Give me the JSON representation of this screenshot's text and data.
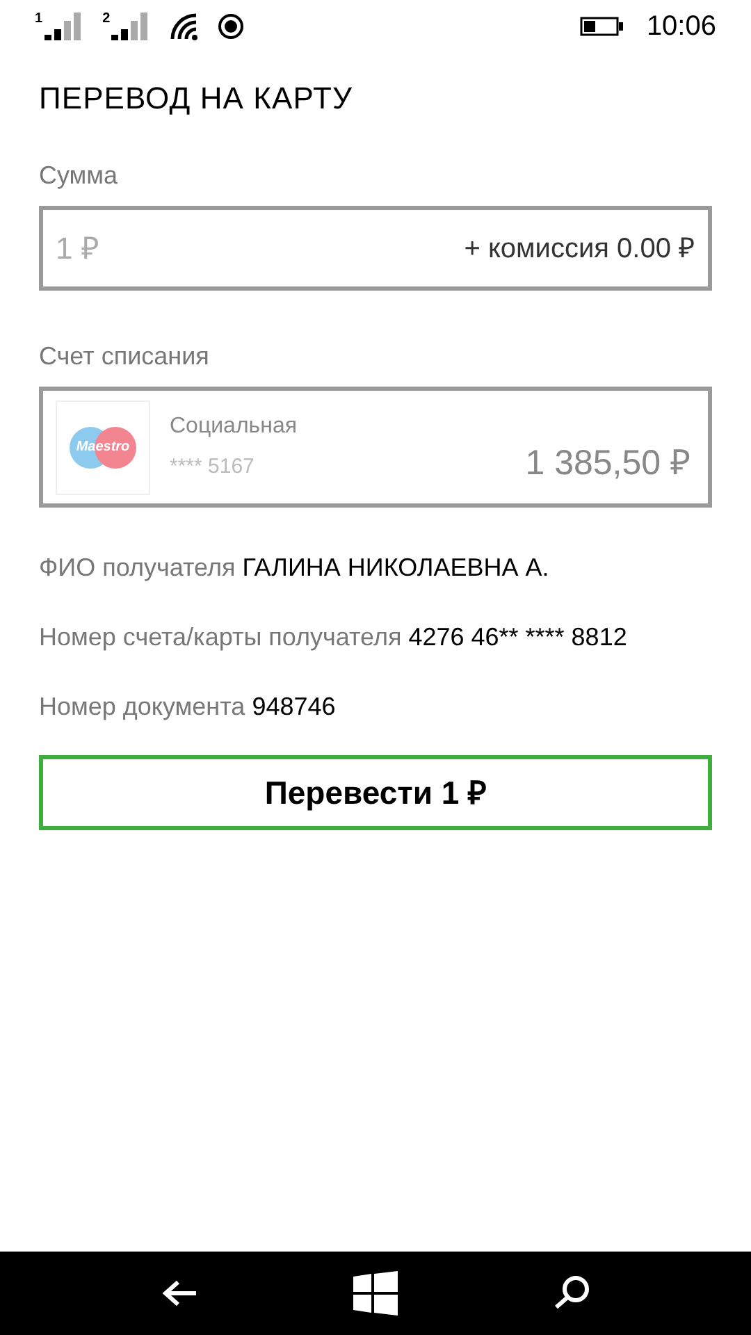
{
  "status_bar": {
    "sims": [
      {
        "label": "1"
      },
      {
        "label": "2"
      }
    ],
    "time": "10:06"
  },
  "title": "ПЕРЕВОД НА КАРТУ",
  "amount": {
    "label": "Сумма",
    "placeholder": "1 ₽",
    "commission": "+ комиссия 0.00 ₽"
  },
  "account": {
    "label": "Счет списания",
    "logo_text": "Maestro",
    "name": "Социальная",
    "number": "**** 5167",
    "balance": "1 385,50 ₽"
  },
  "details": [
    {
      "label": "ФИО получателя",
      "value": "ГАЛИНА НИКОЛАЕВНА А."
    },
    {
      "label": "Номер счета/карты получателя",
      "value": "4276 46** **** 8812"
    },
    {
      "label": "Номер документа",
      "value": "948746"
    }
  ],
  "submit_button": "Перевести 1 ₽"
}
